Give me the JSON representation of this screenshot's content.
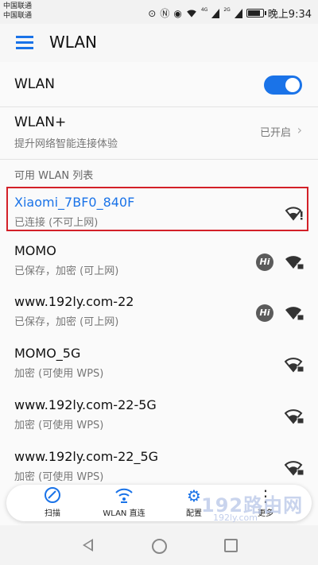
{
  "status_bar": {
    "carrier_1": "中国联通",
    "carrier_2": "中国联通",
    "time": "晚上9:34",
    "icons": [
      "location-icon",
      "nfc-icon",
      "eye-icon",
      "wifi-icon",
      "signal-icon",
      "signal-icon",
      "battery-icon"
    ],
    "mobile_signal_labels": [
      "4G",
      "2G"
    ]
  },
  "header": {
    "title": "WLAN",
    "menu_icon": "menu-icon"
  },
  "wlan_toggle": {
    "label": "WLAN",
    "state": "on"
  },
  "wlan_plus": {
    "title": "WLAN+",
    "subtitle": "提升网络智能连接体验",
    "status": "已开启",
    "chevron": "›"
  },
  "section": {
    "label": "可用 WLAN 列表"
  },
  "networks": [
    {
      "name": "Xiaomi_7BF0_840F",
      "status": "已连接 (不可上网)",
      "connected": true,
      "icon": "wifi-warning-icon",
      "hi": false
    },
    {
      "name": "MOMO",
      "status": "已保存，加密 (可上网)",
      "connected": false,
      "icon": "wifi-lock-icon",
      "hi": true
    },
    {
      "name": "www.192ly.com-22",
      "status": "已保存，加密 (可上网)",
      "connected": false,
      "icon": "wifi-lock-icon",
      "hi": true
    },
    {
      "name": "MOMO_5G",
      "status": "加密 (可使用 WPS)",
      "connected": false,
      "icon": "wifi-lock-icon",
      "hi": false
    },
    {
      "name": "www.192ly.com-22-5G",
      "status": "加密 (可使用 WPS)",
      "connected": false,
      "icon": "wifi-lock-icon",
      "hi": false
    },
    {
      "name": "www.192ly.com-22_5G",
      "status": "加密 (可使用 WPS)",
      "connected": false,
      "icon": "wifi-lock-icon",
      "hi": false
    }
  ],
  "hi_badge": "Hi",
  "bottom_bar": {
    "scan": "扫描",
    "wlan_direct": "WLAN 直连",
    "config": "配置",
    "more": "更多"
  },
  "watermark": {
    "big": "192路由网",
    "small": "192ly.com"
  },
  "colors": {
    "accent": "#1a73e8",
    "highlight_border": "#d32028"
  }
}
